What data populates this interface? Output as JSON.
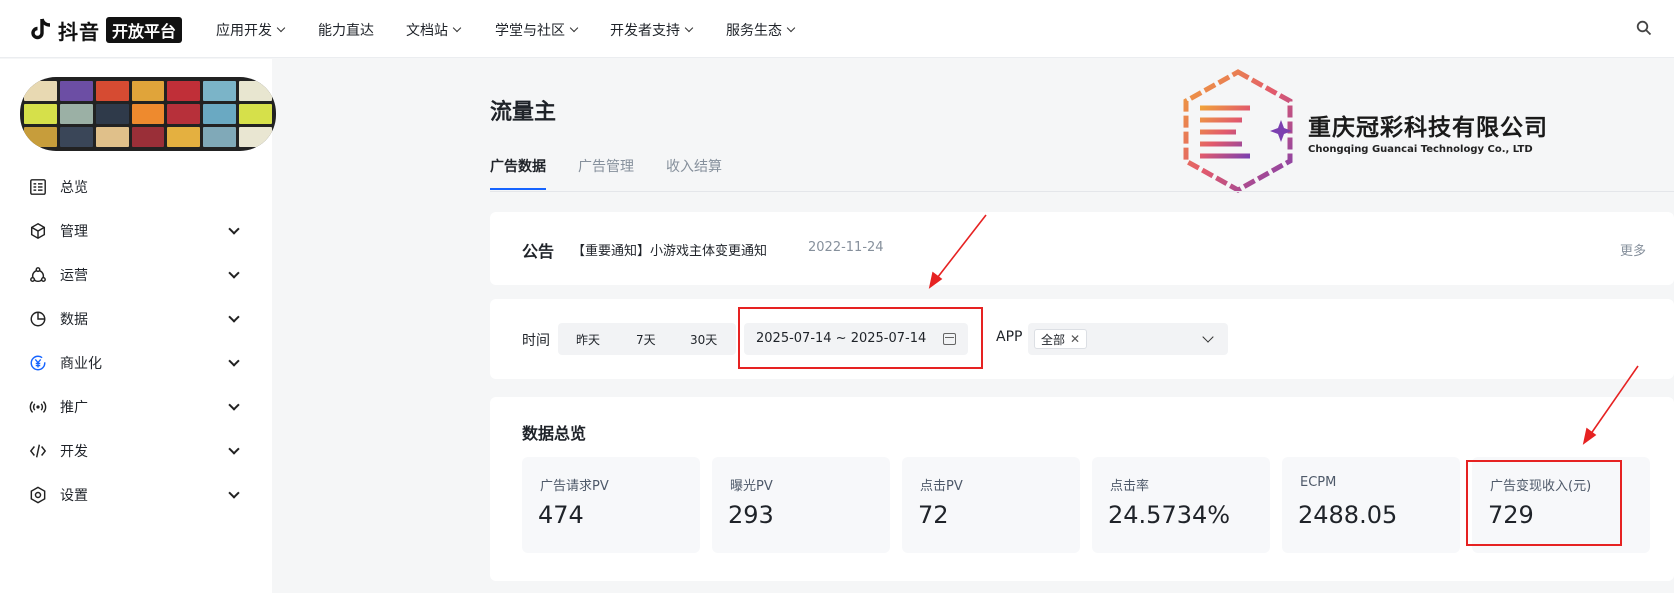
{
  "brand": {
    "name": "抖音",
    "badge": "开放平台"
  },
  "nav": [
    "应用开发",
    "能力直达",
    "文档站",
    "学堂与社区",
    "开发者支持",
    "服务生态"
  ],
  "nav_has_dropdown": [
    true,
    false,
    true,
    true,
    true,
    true
  ],
  "sidebar": {
    "items": [
      {
        "label": "总览",
        "icon": "overview-icon"
      },
      {
        "label": "管理",
        "icon": "cube-icon"
      },
      {
        "label": "运营",
        "icon": "operations-icon"
      },
      {
        "label": "数据",
        "icon": "pie-chart-icon"
      },
      {
        "label": "商业化",
        "icon": "yuan-icon"
      },
      {
        "label": "推广",
        "icon": "broadcast-icon"
      },
      {
        "label": "开发",
        "icon": "code-icon"
      },
      {
        "label": "设置",
        "icon": "settings-icon"
      }
    ]
  },
  "page": {
    "title": "流量主"
  },
  "tabs": [
    "广告数据",
    "广告管理",
    "收入结算"
  ],
  "company": {
    "name_cn": "重庆冠彩科技有限公司",
    "name_en": "Chongqing Guancai Technology Co., LTD"
  },
  "notice": {
    "label": "公告",
    "text": "【重要通知】小游戏主体变更通知",
    "date": "2022-11-24",
    "more": "更多"
  },
  "filter": {
    "time_label": "时间",
    "quick": [
      "昨天",
      "7天",
      "30天"
    ],
    "date_range": "2025-07-14 ~ 2025-07-14",
    "app_label": "APP",
    "app_tag": "全部"
  },
  "overview": {
    "title": "数据总览",
    "metrics": [
      {
        "label": "广告请求PV",
        "value": "474"
      },
      {
        "label": "曝光PV",
        "value": "293"
      },
      {
        "label": "点击PV",
        "value": "72"
      },
      {
        "label": "点击率",
        "value": "24.5734%"
      },
      {
        "label": "ECPM",
        "value": "2488.05"
      },
      {
        "label": "广告变现收入(元)",
        "value": "729"
      }
    ]
  },
  "colors": {
    "accent": "#1664ff",
    "annotation": "#e62222"
  }
}
